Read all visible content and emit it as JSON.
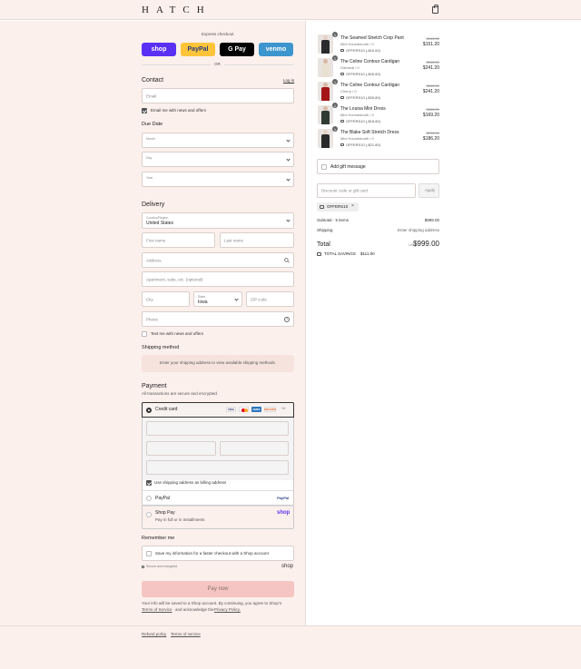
{
  "header": {
    "logo": "HATCH"
  },
  "express": {
    "title": "Express checkout",
    "buttons": [
      {
        "label": "shop",
        "bg": "#5a31f4",
        "fg": "#ffffff"
      },
      {
        "label": "PayPal",
        "bg": "#ffc439",
        "fg": "#253b80"
      },
      {
        "label": "G Pay",
        "bg": "#000000",
        "fg": "#ffffff"
      },
      {
        "label": "venmo",
        "bg": "#3d95ce",
        "fg": "#ffffff"
      }
    ],
    "or": "OR"
  },
  "contact": {
    "title": "Contact",
    "login": "Log in",
    "email_placeholder": "Email",
    "news_label": "Email me with news and offers"
  },
  "due_date": {
    "title": "Due Date",
    "month": "Month",
    "day": "Day",
    "year": "Year"
  },
  "delivery": {
    "title": "Delivery",
    "country_label": "Country/Region",
    "country_value": "United States",
    "first_name": "First name",
    "last_name": "Last name",
    "address": "Address",
    "apartment": "Apartment, suite, etc. (optional)",
    "city": "City",
    "state_label": "State",
    "state_value": "Iowa",
    "zip": "ZIP code",
    "phone": "Phone",
    "text_label": "Text me with news and offers"
  },
  "shipping_method": {
    "title": "Shipping method",
    "notice": "Enter your shipping address to view available shipping methods."
  },
  "payment": {
    "title": "Payment",
    "subtitle": "All transactions are secure and encrypted.",
    "credit_card": "Credit card",
    "cards": [
      {
        "name": "VISA",
        "bg": "#ffffff",
        "fg": "#1a1f71"
      },
      {
        "name": "MC",
        "bg": "#ffffff",
        "fg": "#eb001b"
      },
      {
        "name": "AMEX",
        "bg": "#2e77bc",
        "fg": "#ffffff"
      },
      {
        "name": "DISCOVER",
        "bg": "#ffffff",
        "fg": "#e55c20"
      }
    ],
    "more_cards": "+4",
    "billing_label": "Use shipping address as billing address",
    "paypal": "PayPal",
    "paypal_logo": "PayPal",
    "shop_pay": "Shop Pay",
    "shop_pay_sub": "Pay in full or in installments",
    "shop_logo": "shop"
  },
  "remember": {
    "title": "Remember me",
    "save_label": "Save my information for a faster checkout with a Shop account",
    "secure": "Secure and encrypted",
    "shop_logo": "shop"
  },
  "pay_button": "Pay now",
  "legal": {
    "line1": "Your info will be saved to a Shop account. By continuing, you agree to Shop’s",
    "tos": "Terms of Service",
    "and": "and acknowledge the",
    "privacy": "Privacy Policy."
  },
  "footer": {
    "refund": "Refund policy",
    "terms": "Terms of service"
  },
  "order": {
    "items": [
      {
        "qty": "1",
        "name": "The Seamed Stretch Crop Pant",
        "variant": "Mini Houndstooth / 0",
        "discount": "OFFERS10 (-$16.82)",
        "orig": "$168.00",
        "price": "$151.20",
        "color": "#2b2a2e",
        "skin": "#e6d2c4"
      },
      {
        "qty": "1",
        "name": "The Celine Contour Cardigan",
        "variant": "Oatmeal / 0",
        "discount": "OFFERS10 (-$26.80)",
        "orig": "$268.00",
        "price": "$241.20",
        "color": "#e9e0d2",
        "skin": "#d9b8a3"
      },
      {
        "qty": "1",
        "name": "The Celine Contour Cardigan",
        "variant": "Cherry / 0",
        "discount": "OFFERS10 (-$26.80)",
        "orig": "$268.00",
        "price": "$241.20",
        "color": "#a51616",
        "skin": "#d9b8a3"
      },
      {
        "qty": "1",
        "name": "The Louisa Mini Dress",
        "variant": "Mini Houndstooth / 0",
        "discount": "OFFERS10 (-$18.80)",
        "orig": "$188.00",
        "price": "$169.20",
        "color": "#2f3a33",
        "skin": "#d9b8a3"
      },
      {
        "qty": "1",
        "name": "The Blake Soft Stretch Dress",
        "variant": "Mini Houndstooth / 0",
        "discount": "OFFERS10 (-$21.80)",
        "orig": "$218.00",
        "price": "$186.20",
        "color": "#2a2a2a",
        "skin": "#e6d2c4"
      }
    ],
    "gift": "Add gift message",
    "discount_placeholder": "Discount code or gift card",
    "apply": "Apply",
    "code": "OFFERS10",
    "subtotal_label": "Subtotal · 5 items",
    "subtotal": "$999.00",
    "shipping_label": "Shipping",
    "shipping": "Enter shipping address",
    "total_label": "Total",
    "currency": "USD",
    "total": "$999.00",
    "savings_label": "TOTAL SAVINGS",
    "savings": "$111.00"
  }
}
